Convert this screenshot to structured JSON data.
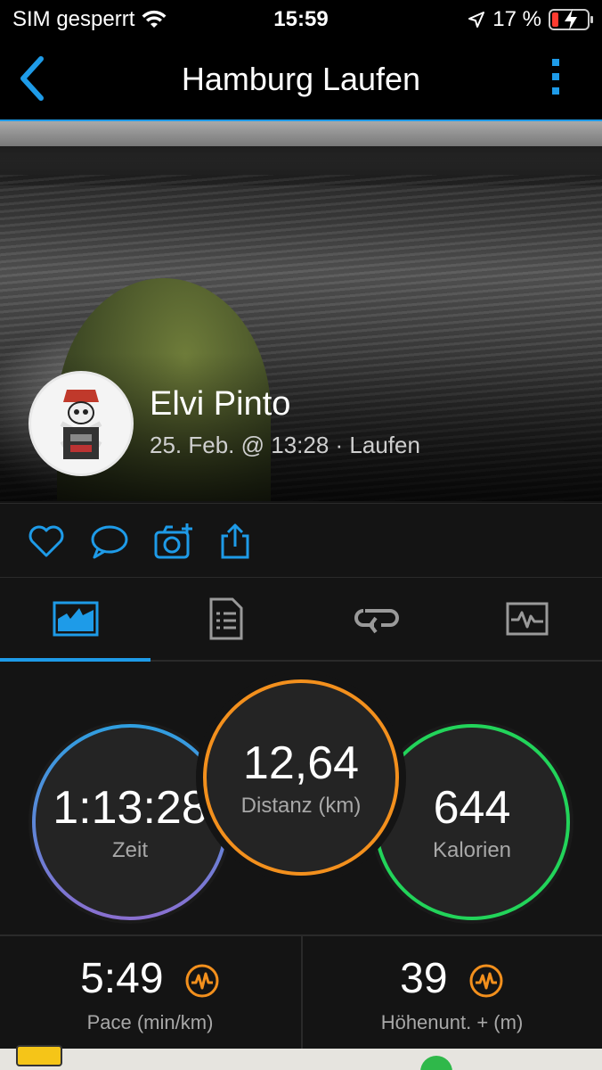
{
  "status_bar": {
    "carrier": "SIM gesperrt",
    "time": "15:59",
    "battery_percent": "17 %",
    "icons": [
      "wifi-icon",
      "location-arrow-icon",
      "battery-charging-icon"
    ]
  },
  "header": {
    "title": "Hamburg Laufen",
    "back_icon": "chevron-left-icon",
    "more_icon": "more-vertical-icon"
  },
  "activity": {
    "user_name": "Elvi Pinto",
    "meta": "25. Feb. @ 13:28 · Laufen"
  },
  "actions": [
    "heart-icon",
    "comment-icon",
    "add-photo-icon",
    "share-icon"
  ],
  "tabs": [
    {
      "icon": "stats-chart-icon",
      "selected": true
    },
    {
      "icon": "details-list-icon",
      "selected": false
    },
    {
      "icon": "laps-icon",
      "selected": false
    },
    {
      "icon": "graphs-icon",
      "selected": false
    }
  ],
  "stats": {
    "time": {
      "value": "1:13:28",
      "label": "Zeit"
    },
    "distance": {
      "value": "12,64",
      "label": "Distanz (km)"
    },
    "calories": {
      "value": "644",
      "label": "Kalorien"
    }
  },
  "bottom_stats": {
    "pace": {
      "value": "5:49",
      "label": "Pace (min/km)"
    },
    "elevation": {
      "value": "39",
      "label": "Höhenunt. + (m)"
    }
  },
  "colors": {
    "accent": "#1e9be8",
    "distance_ring": "#f3901d",
    "calories_ring": "#22d45a",
    "time_ring_top": "#2f9fe0",
    "time_ring_bottom": "#8a6fd0",
    "insight_icon": "#f3901d"
  }
}
